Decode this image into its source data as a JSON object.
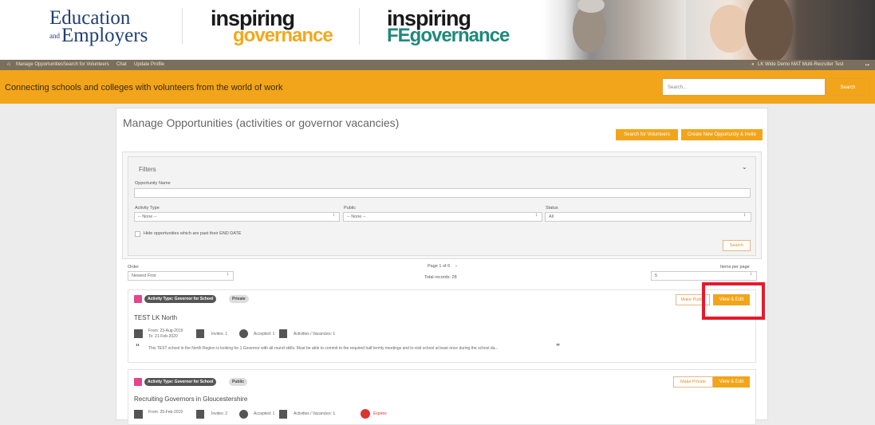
{
  "header": {
    "logo_ee_top": "Education",
    "logo_ee_and": "and",
    "logo_ee_bottom": "Employers",
    "logo_ig_a": "inspiring",
    "logo_ig_b": "governance",
    "logo_fe_a": "inspiring",
    "logo_fe_b": "FEgovernance"
  },
  "nav": {
    "items": [
      "Manage Opportunities",
      "Search for Volunteers",
      "Chat",
      "Update Profile"
    ],
    "user": "LK Wide Demo MAT Multi-Recruiter Test"
  },
  "strip": {
    "tagline": "Connecting schools and colleges with volunteers from the world of work",
    "search_placeholder": "Search...",
    "search_button": "Search"
  },
  "page": {
    "title": "Manage Opportunities (activities or governor vacancies)",
    "search_volunteers_button": "Search for Volunteers",
    "create_button": "Create New Opportunity & Invite"
  },
  "filters": {
    "heading": "Filters",
    "name_label": "Opportunity Name",
    "activity_type_label": "Activity Type",
    "activity_type_value": "-- None --",
    "public_label": "Public",
    "public_value": "-- None --",
    "status_label": "Status",
    "status_value": "All",
    "hide_label": "Hide opportunities which are past their END DATE",
    "search_button": "Search"
  },
  "listing": {
    "order_label": "Order",
    "order_value": "Newest First",
    "page_info": "Page 1 of 6",
    "total_records": "Total records: 28",
    "items_label": "Items per page",
    "items_value": "5"
  },
  "cards": [
    {
      "type": "Activity Type: Governor for School",
      "visibility": "Private",
      "toggle_button": "Make Public",
      "edit_button": "View & Edit",
      "title": "TEST LK North",
      "from": "From: 23-Aug-2019",
      "to": "To: 21-Feb-2020",
      "invites": "Invites: 1",
      "accepted": "Accepted: 1",
      "activities": "Activities / Vacancies: 1",
      "description": "This TEST school in the North Region is looking for 1 Governor with all-round skills. Must be able to commit to the required half termly meetings and to visit school at least once during the school da..."
    },
    {
      "type": "Activity Type: Governor for School",
      "visibility": "Public",
      "toggle_button": "Make Private",
      "edit_button": "View & Edit",
      "title": "Recruiting Governors in Gloucestershire",
      "from": "From: 25-Feb-2019",
      "invites": "Invites: 2",
      "accepted": "Accepted: 1",
      "activities": "Activities / Vacancies: 1",
      "expires": "Expires"
    }
  ]
}
